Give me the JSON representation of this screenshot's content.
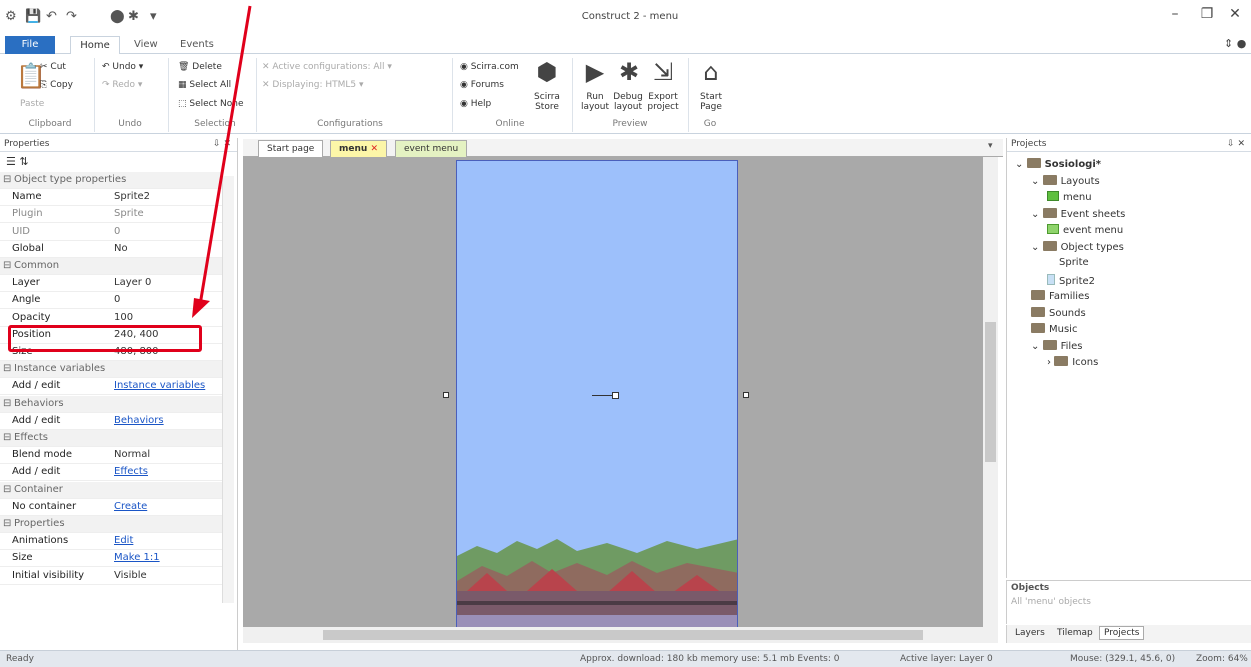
{
  "app_title": "Construct 2 - menu",
  "quick_access": [
    "⚙",
    "💾",
    "↶",
    "↷",
    "⬤",
    "✱",
    "▾"
  ],
  "ribbon_tabs": [
    "File",
    "Home",
    "View",
    "Events"
  ],
  "ribbon": {
    "clipboard": {
      "paste": "Paste",
      "cut": "Cut",
      "copy": "Copy",
      "label": "Clipboard"
    },
    "undo": {
      "undo": "Undo",
      "redo": "Redo",
      "label": "Undo"
    },
    "selection": {
      "delete": "Delete",
      "select_all": "Select All",
      "select_none": "Select None",
      "label": "Selection"
    },
    "configurations": {
      "active": "Active configurations: All",
      "displaying": "Displaying: HTML5",
      "label": "Configurations"
    },
    "online": {
      "scirra": "Scirra.com",
      "forums": "Forums",
      "help": "Help",
      "store": "Scirra Store",
      "label": "Online"
    },
    "preview": {
      "run": "Run layout",
      "debug": "Debug layout",
      "export": "Export project",
      "label": "Preview"
    },
    "go": {
      "start": "Start Page",
      "label": "Go"
    }
  },
  "properties": {
    "title": "Properties",
    "rows": [
      {
        "k": "Object type properties",
        "sec": true
      },
      {
        "k": "Name",
        "v": "Sprite2"
      },
      {
        "k": "Plugin",
        "v": "Sprite",
        "dim": true
      },
      {
        "k": "UID",
        "v": "0",
        "dim": true
      },
      {
        "k": "Global",
        "v": "No"
      },
      {
        "k": "Common",
        "sec": true
      },
      {
        "k": "Layer",
        "v": "Layer 0"
      },
      {
        "k": "Angle",
        "v": "0"
      },
      {
        "k": "Opacity",
        "v": "100"
      },
      {
        "k": "Position",
        "v": "240, 400"
      },
      {
        "k": "Size",
        "v": "480, 800"
      },
      {
        "k": "Instance variables",
        "sec": true
      },
      {
        "k": "Add / edit",
        "v": "Instance variables",
        "link": true
      },
      {
        "k": "Behaviors",
        "sec": true
      },
      {
        "k": "Add / edit",
        "v": "Behaviors",
        "link": true
      },
      {
        "k": "Effects",
        "sec": true
      },
      {
        "k": "Blend mode",
        "v": "Normal"
      },
      {
        "k": "Add / edit",
        "v": "Effects",
        "link": true
      },
      {
        "k": "Container",
        "sec": true
      },
      {
        "k": "No container",
        "v": "Create",
        "link": true
      },
      {
        "k": "Properties",
        "sec": true
      },
      {
        "k": "Animations",
        "v": "Edit",
        "link": true
      },
      {
        "k": "Size",
        "v": "Make 1:1",
        "link": true
      },
      {
        "k": "Initial visibility",
        "v": "Visible"
      }
    ]
  },
  "doc_tabs": [
    "Start page",
    "menu",
    "event menu"
  ],
  "projects": {
    "title": "Projects",
    "tree": [
      {
        "label": "Sosiologi*",
        "icon": "folder",
        "indent": 0,
        "bold": true
      },
      {
        "label": "Layouts",
        "icon": "folder",
        "indent": 1
      },
      {
        "label": "menu",
        "icon": "layout",
        "indent": 2
      },
      {
        "label": "Event sheets",
        "icon": "folder",
        "indent": 1
      },
      {
        "label": "event menu",
        "icon": "event",
        "indent": 2
      },
      {
        "label": "Object types",
        "icon": "folder",
        "indent": 1
      },
      {
        "label": "Sprite",
        "icon": "none",
        "indent": 2
      },
      {
        "label": "Sprite2",
        "icon": "sprite",
        "indent": 2
      },
      {
        "label": "Families",
        "icon": "folder",
        "indent": 1
      },
      {
        "label": "Sounds",
        "icon": "folder",
        "indent": 1
      },
      {
        "label": "Music",
        "icon": "folder",
        "indent": 1
      },
      {
        "label": "Files",
        "icon": "folder",
        "indent": 1
      },
      {
        "label": "Icons",
        "icon": "folder",
        "indent": 2
      }
    ]
  },
  "objects": {
    "title": "Objects",
    "placeholder": "All 'menu' objects"
  },
  "bottom_tabs": [
    "Layers",
    "Tilemap",
    "Projects"
  ],
  "status": {
    "ready": "Ready",
    "download": "Approx. download: 180 kb  memory use: 5.1 mb  Events: 0",
    "active_layer": "Active layer: Layer 0",
    "mouse": "Mouse: (329.1, 45.6, 0)",
    "zoom": "Zoom: 64%"
  },
  "colors": {
    "accent": "#2a6fc2",
    "layout_bg": "#9dc0fb",
    "highlight": "#e0001b"
  }
}
